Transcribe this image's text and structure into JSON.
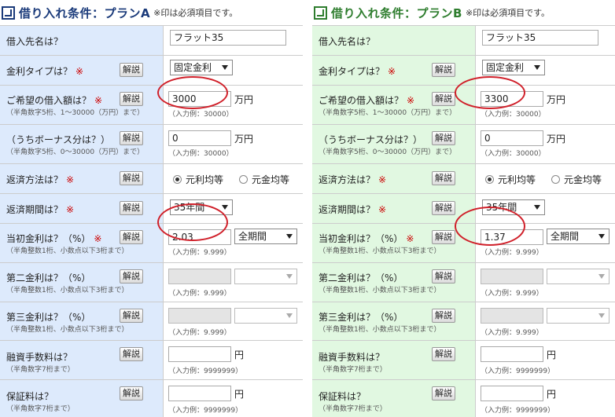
{
  "note": "※印は必須項目です。",
  "required_mark": "※",
  "help_label": "解説",
  "plans": {
    "a": {
      "title": "借り入れ条件：プランA",
      "accent_color": "#1a3a7a",
      "label_bg": "#ddeafc",
      "lender_label": "借入先名は？",
      "lender_value": "フラット35",
      "rate_type_label": "金利タイプは？",
      "rate_type_value": "固定金利",
      "loan_label": "ご希望の借入額は？",
      "loan_sub": "（半角数字5桁、1～30000（万円）まで）",
      "loan_value": "3000",
      "loan_unit": "万円",
      "loan_hint": "（入力例：30000）",
      "bonus_label": "（うちボーナス分は？）",
      "bonus_sub": "（半角数字5桁、0～30000（万円）まで）",
      "bonus_value": "0",
      "bonus_unit": "万円",
      "bonus_hint": "（入力例：30000）",
      "method_label": "返済方法は？",
      "method_option1": "元利均等",
      "method_option2": "元金均等",
      "method_selected": "元利均等",
      "period_label": "返済期間は？",
      "period_value": "35年間",
      "initial_rate_label": "当初金利は？（%）",
      "initial_rate_sub": "（半角整数1桁、小数点以下3桁まで）",
      "initial_rate_value": "2.03",
      "initial_rate_hint": "（入力例：9.999）",
      "initial_period_value": "全期間",
      "second_rate_label": "第二金利は？（%）",
      "second_rate_sub": "（半角整数1桁、小数点以下3桁まで）",
      "second_rate_value": "",
      "second_rate_hint": "（入力例：9.999）",
      "third_rate_label": "第三金利は？（%）",
      "third_rate_sub": "（半角整数1桁、小数点以下3桁まで）",
      "third_rate_value": "",
      "third_rate_hint": "（入力例：9.999）",
      "fee_label": "融資手数料は？",
      "fee_sub": "（半角数字7桁まで）",
      "fee_value": "",
      "fee_unit": "円",
      "fee_hint": "（入力例：9999999）",
      "guarantee_label": "保証料は？",
      "guarantee_sub": "（半角数字7桁まで）",
      "guarantee_value": "",
      "guarantee_unit": "円",
      "guarantee_hint": "（入力例：9999999）"
    },
    "b": {
      "title": "借り入れ条件：プランB",
      "accent_color": "#2e7d2e",
      "label_bg": "#e1f8e1",
      "lender_label": "借入先名は？",
      "lender_value": "フラット35",
      "rate_type_label": "金利タイプは？",
      "rate_type_value": "固定金利",
      "loan_label": "ご希望の借入額は？",
      "loan_sub": "（半角数字5桁、1～30000（万円）まで）",
      "loan_value": "3300",
      "loan_unit": "万円",
      "loan_hint": "（入力例：30000）",
      "bonus_label": "（うちボーナス分は？）",
      "bonus_sub": "（半角数字5桁、0～30000（万円）まで）",
      "bonus_value": "0",
      "bonus_unit": "万円",
      "bonus_hint": "（入力例：30000）",
      "method_label": "返済方法は？",
      "method_option1": "元利均等",
      "method_option2": "元金均等",
      "method_selected": "元利均等",
      "period_label": "返済期間は？",
      "period_value": "35年間",
      "initial_rate_label": "当初金利は？（%）",
      "initial_rate_sub": "（半角整数1桁、小数点以下3桁まで）",
      "initial_rate_value": "1.37",
      "initial_rate_hint": "（入力例：9.999）",
      "initial_period_value": "全期間",
      "second_rate_label": "第二金利は？（%）",
      "second_rate_sub": "（半角整数1桁、小数点以下3桁まで）",
      "second_rate_value": "",
      "second_rate_hint": "（入力例：9.999）",
      "third_rate_label": "第三金利は？（%）",
      "third_rate_sub": "（半角整数1桁、小数点以下3桁まで）",
      "third_rate_value": "",
      "third_rate_hint": "（入力例：9.999）",
      "fee_label": "融資手数料は？",
      "fee_sub": "（半角数字7桁まで）",
      "fee_value": "",
      "fee_unit": "円",
      "fee_hint": "（入力例：9999999）",
      "guarantee_label": "保証料は？",
      "guarantee_sub": "（半角数字7桁まで）",
      "guarantee_value": "",
      "guarantee_unit": "円",
      "guarantee_hint": "（入力例：9999999）"
    }
  },
  "highlight_color": "#d0202a"
}
